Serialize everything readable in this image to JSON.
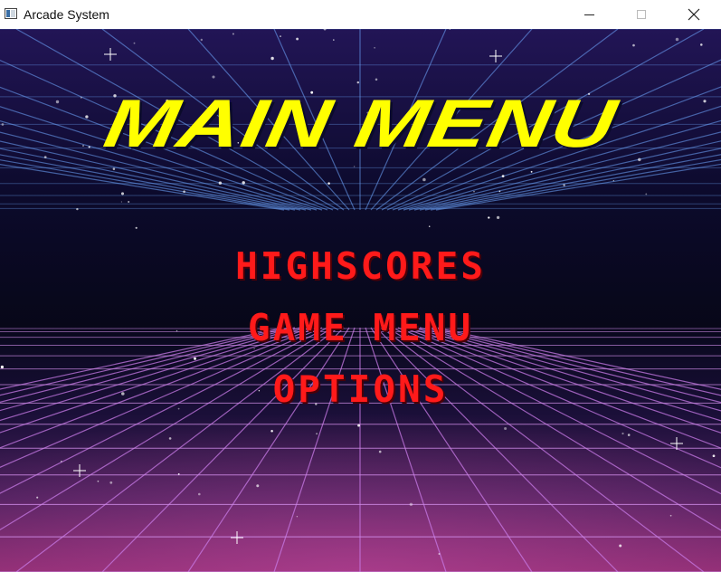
{
  "window": {
    "title": "Arcade System",
    "controls": {
      "minimize": "minimize",
      "maximize": "maximize",
      "close": "close"
    },
    "close_glyph": "✕"
  },
  "menu": {
    "title": "MAIN MENU",
    "items": [
      {
        "label": "HIGHSCORES"
      },
      {
        "label": "GAME MENU"
      },
      {
        "label": "OPTIONS"
      }
    ]
  },
  "colors": {
    "title": "#ffff00",
    "menu_item": "#ff1a1a",
    "sky_top": "#1a0b3d",
    "horizon": "#0a0a24",
    "floor_bottom": "#8a2a6e",
    "grid": "#b070e0"
  }
}
